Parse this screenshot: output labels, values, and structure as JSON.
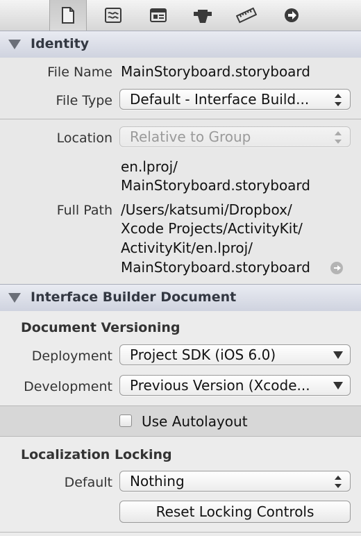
{
  "toolbar": {
    "icons": [
      "file-inspector-icon",
      "quick-help-icon",
      "identity-inspector-icon",
      "attributes-inspector-icon",
      "size-inspector-icon",
      "connections-inspector-icon"
    ]
  },
  "identity": {
    "title": "Identity",
    "file_name_label": "File Name",
    "file_name_value": "MainStoryboard.storyboard",
    "file_type_label": "File Type",
    "file_type_value": "Default - Interface Build...",
    "location_label": "Location",
    "location_value": "Relative to Group",
    "relative_path_line1": "en.lproj/",
    "relative_path_line2": "MainStoryboard.storyboard",
    "full_path_label": "Full Path",
    "full_path_lines": [
      "/Users/katsumi/Dropbox/",
      "Xcode Projects/ActivityKit/",
      "ActivityKit/en.lproj/",
      "MainStoryboard.storyboard"
    ]
  },
  "ib_document": {
    "title": "Interface Builder Document",
    "versioning_title": "Document Versioning",
    "deployment_label": "Deployment",
    "deployment_value": "Project SDK (iOS 6.0)",
    "development_label": "Development",
    "development_value": "Previous Version (Xcode...",
    "autolayout_label": "Use Autolayout",
    "autolayout_checked": false,
    "localization_title": "Localization Locking",
    "default_label": "Default",
    "default_value": "Nothing",
    "reset_button": "Reset Locking Controls"
  }
}
